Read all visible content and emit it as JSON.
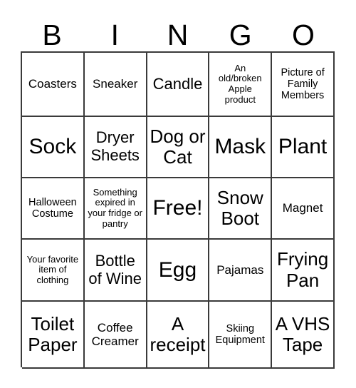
{
  "card": {
    "headers": [
      "B",
      "I",
      "N",
      "G",
      "O"
    ],
    "border_color": "#3a3a3a",
    "background_color": "#ffffff",
    "text_color": "#000000",
    "rows": [
      [
        {
          "text": "Coasters",
          "size": "m"
        },
        {
          "text": "Sneaker",
          "size": "m"
        },
        {
          "text": "Candle",
          "size": "l"
        },
        {
          "text": "An old/broken Apple product",
          "size": "xs"
        },
        {
          "text": "Picture of Family Members",
          "size": "s"
        }
      ],
      [
        {
          "text": "Sock",
          "size": "xxl"
        },
        {
          "text": "Dryer Sheets",
          "size": "l"
        },
        {
          "text": "Dog or Cat",
          "size": "xl"
        },
        {
          "text": "Mask",
          "size": "xxl"
        },
        {
          "text": "Plant",
          "size": "xxl"
        }
      ],
      [
        {
          "text": "Halloween Costume",
          "size": "s"
        },
        {
          "text": "Something expired in your fridge or pantry",
          "size": "xs"
        },
        {
          "text": "Free!",
          "size": "xxl"
        },
        {
          "text": "Snow Boot",
          "size": "xl"
        },
        {
          "text": "Magnet",
          "size": "m"
        }
      ],
      [
        {
          "text": "Your favorite item of clothing",
          "size": "xs"
        },
        {
          "text": "Bottle of Wine",
          "size": "l"
        },
        {
          "text": "Egg",
          "size": "xxl"
        },
        {
          "text": "Pajamas",
          "size": "m"
        },
        {
          "text": "Frying Pan",
          "size": "xl"
        }
      ],
      [
        {
          "text": "Toilet Paper",
          "size": "xl"
        },
        {
          "text": "Coffee Creamer",
          "size": "m"
        },
        {
          "text": "A receipt",
          "size": "xl"
        },
        {
          "text": "Skiing Equipment",
          "size": "s"
        },
        {
          "text": "A VHS Tape",
          "size": "xl"
        }
      ]
    ]
  }
}
